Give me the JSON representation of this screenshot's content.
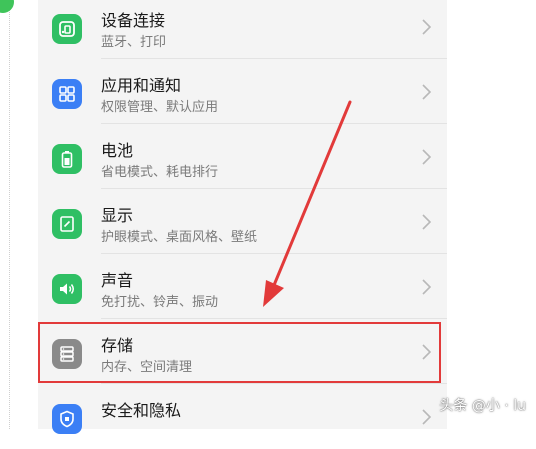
{
  "settings": {
    "items": [
      {
        "title": "设备连接",
        "subtitle": "蓝牙、打印",
        "icon": "device-connection-icon",
        "color": "#2fbf64"
      },
      {
        "title": "应用和通知",
        "subtitle": "权限管理、默认应用",
        "icon": "apps-icon",
        "color": "#3b7ff5"
      },
      {
        "title": "电池",
        "subtitle": "省电模式、耗电排行",
        "icon": "battery-icon",
        "color": "#2fbf64"
      },
      {
        "title": "显示",
        "subtitle": "护眼模式、桌面风格、壁纸",
        "icon": "display-icon",
        "color": "#2fbf64"
      },
      {
        "title": "声音",
        "subtitle": "免打扰、铃声、振动",
        "icon": "sound-icon",
        "color": "#2fbf64"
      },
      {
        "title": "存储",
        "subtitle": "内存、空间清理",
        "icon": "storage-icon",
        "color": "#8a8a8a"
      },
      {
        "title": "安全和隐私",
        "subtitle": "",
        "icon": "security-icon",
        "color": "#3b7ff5"
      }
    ]
  },
  "annotation": {
    "highlight_color": "#e23a3a"
  },
  "watermark": {
    "text": "头条 @小 · lu"
  }
}
